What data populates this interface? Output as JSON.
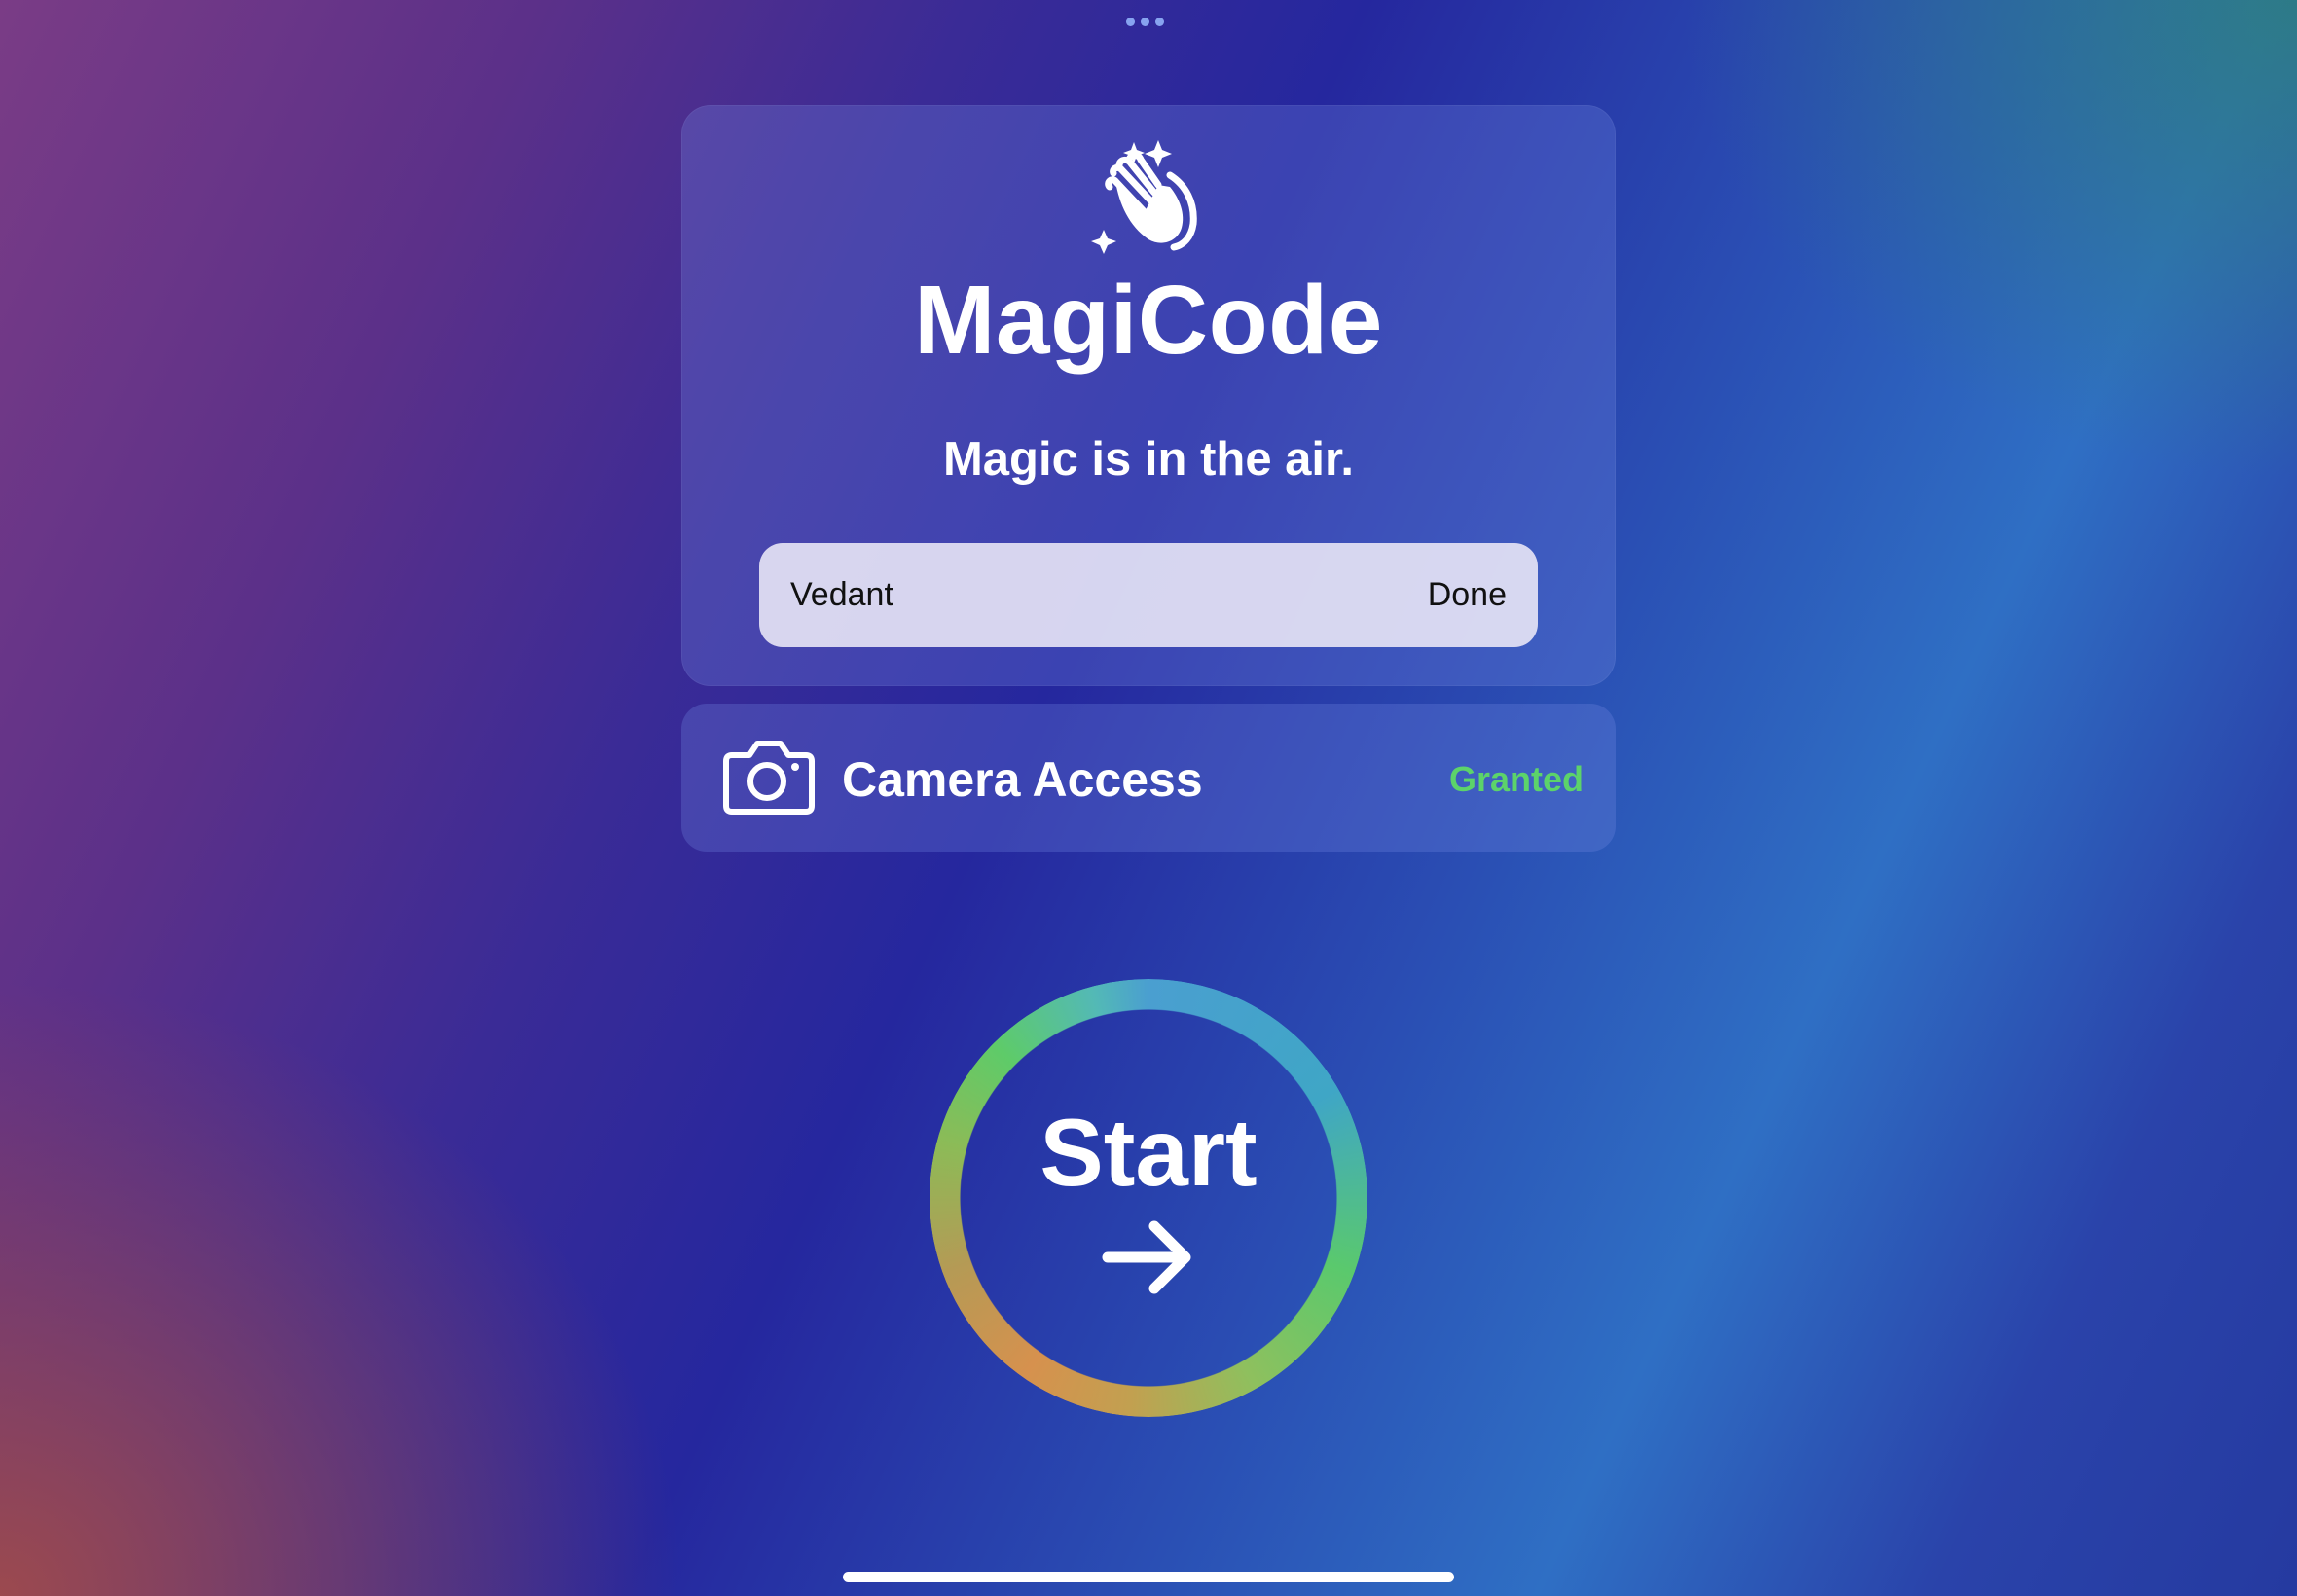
{
  "app": {
    "title": "MagiCode",
    "tagline": "Magic is in the air."
  },
  "name_field": {
    "value": "Vedant",
    "done_label": "Done"
  },
  "camera": {
    "label": "Camera Access",
    "status": "Granted",
    "status_color": "#5cd36a"
  },
  "start": {
    "label": "Start"
  },
  "icons": {
    "hero": "hands-clapping-sparkles-icon",
    "camera": "camera-icon",
    "arrow": "arrow-right-icon"
  }
}
